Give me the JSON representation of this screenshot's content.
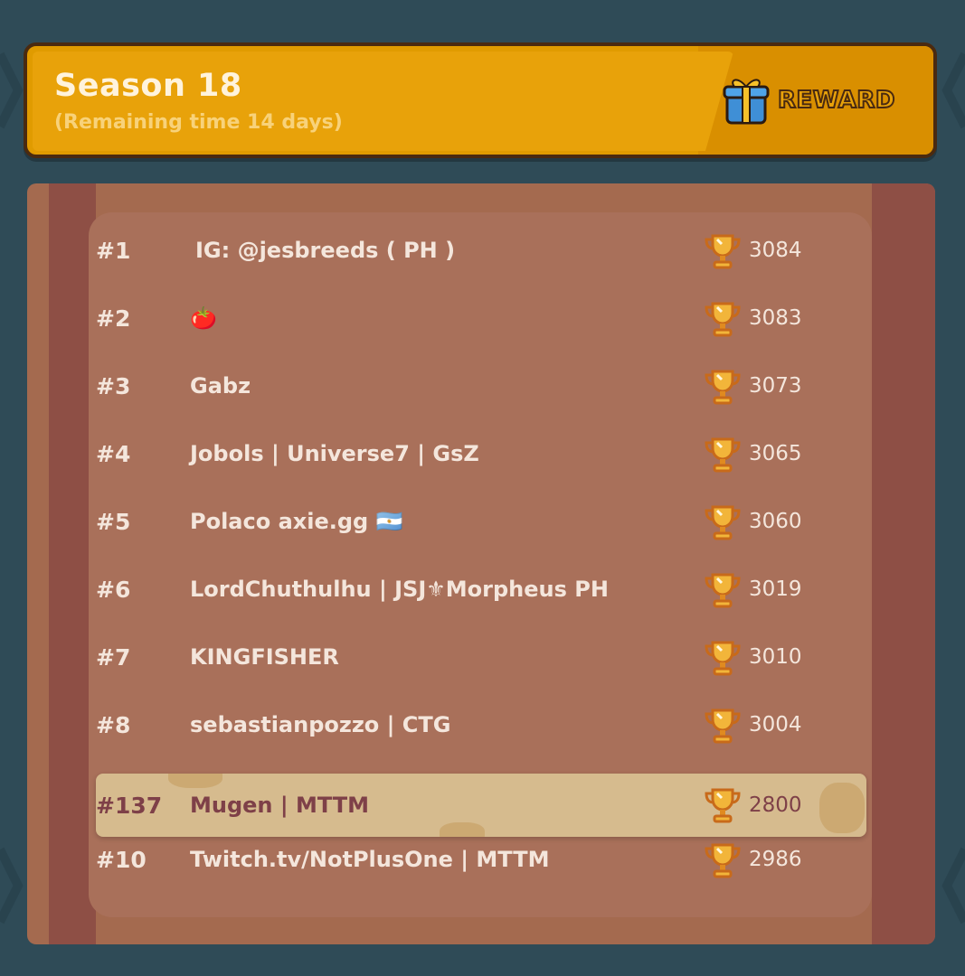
{
  "header": {
    "title": "Season 18",
    "subtitle": "(Remaining time 14 days)",
    "reward_label": "REWARD"
  },
  "leaderboard": {
    "rows": [
      {
        "rank": "#1",
        "name": "IG: @jesbreeds ( PH )",
        "score": "3084"
      },
      {
        "rank": "#2",
        "name": "🍅",
        "score": "3083"
      },
      {
        "rank": "#3",
        "name": "Gabz",
        "score": "3073"
      },
      {
        "rank": "#4",
        "name": "Jobols | Universe7 | GsZ",
        "score": "3065"
      },
      {
        "rank": "#5",
        "name": "Polaco axie.gg 🇦🇷",
        "score": "3060"
      },
      {
        "rank": "#6",
        "name": "LordChuthulhu | JSJ⚜Morpheus PH",
        "score": "3019"
      },
      {
        "rank": "#7",
        "name": "KINGFISHER",
        "score": "3010"
      },
      {
        "rank": "#8",
        "name": "sebastianpozzo | CTG",
        "score": "3004"
      }
    ],
    "current_player": {
      "rank": "#137",
      "name": "Mugen | MTTM",
      "score": "2800"
    },
    "after_rows": [
      {
        "rank": "#10",
        "name": "Twitch.tv/NotPlusOne | MTTM",
        "score": "2986"
      }
    ]
  },
  "colors": {
    "background": "#2f4b57",
    "banner": "#e09b00",
    "board": "#a46a4f",
    "highlight": "#d6bb8e"
  },
  "icons": {
    "reward": "gift-icon",
    "score": "trophy-icon"
  }
}
